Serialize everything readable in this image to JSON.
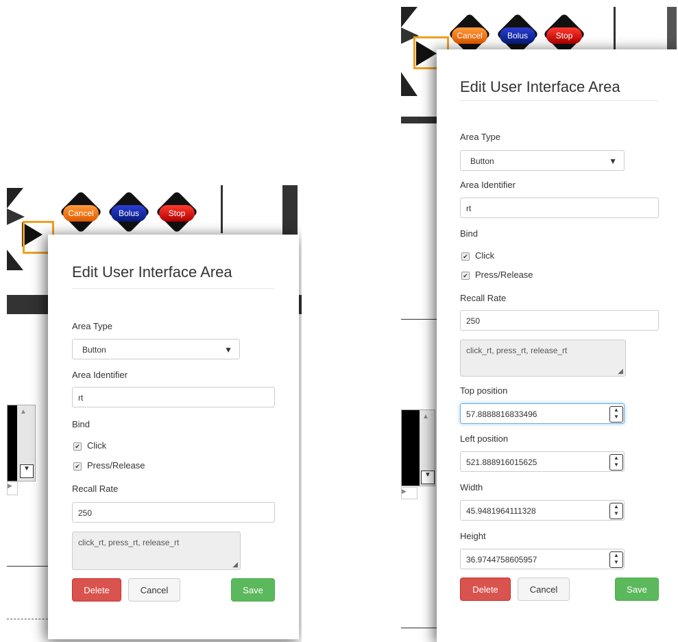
{
  "device": {
    "cancel_label": "Cancel",
    "bolus_label": "Bolus",
    "stop_label": "Stop"
  },
  "left_dialog": {
    "title": "Edit User Interface Area",
    "area_type_label": "Area Type",
    "area_type_value": "Button",
    "area_identifier_label": "Area Identifier",
    "area_identifier_value": "rt",
    "bind_label": "Bind",
    "click_label": "Click",
    "press_release_label": "Press/Release",
    "recall_rate_label": "Recall Rate",
    "recall_rate_value": "250",
    "events_text": "click_rt, press_rt, release_rt",
    "delete_label": "Delete",
    "cancel_label": "Cancel",
    "save_label": "Save"
  },
  "right_dialog": {
    "title": "Edit User Interface Area",
    "area_type_label": "Area Type",
    "area_type_value": "Button",
    "area_identifier_label": "Area Identifier",
    "area_identifier_value": "rt",
    "bind_label": "Bind",
    "click_label": "Click",
    "press_release_label": "Press/Release",
    "recall_rate_label": "Recall Rate",
    "recall_rate_value": "250",
    "events_text": "click_rt, press_rt, release_rt",
    "top_position_label": "Top position",
    "top_position_value": "57.8888816833496",
    "left_position_label": "Left position",
    "left_position_value": "521.888916015625",
    "width_label": "Width",
    "width_value": "45.9481964111328",
    "height_label": "Height",
    "height_value": "36.9744758605957",
    "delete_label": "Delete",
    "cancel_label": "Cancel",
    "save_label": "Save"
  },
  "icons": {
    "dropdown": "triangle-down-icon",
    "checkbox": "checkbox-checked-icon",
    "spinner": "spinner-up-down-icon",
    "resize": "resize-grip-icon",
    "scroll_up": "scroll-up-arrow-icon",
    "scroll_down": "scroll-down-arrow-icon"
  },
  "colors": {
    "cancel_device": "#f07a1a",
    "bolus_device": "#0c1f9e",
    "stop_device": "#d40f0f",
    "delete": "#d9534f",
    "save": "#5cb85c",
    "selection": "#f0a020"
  }
}
